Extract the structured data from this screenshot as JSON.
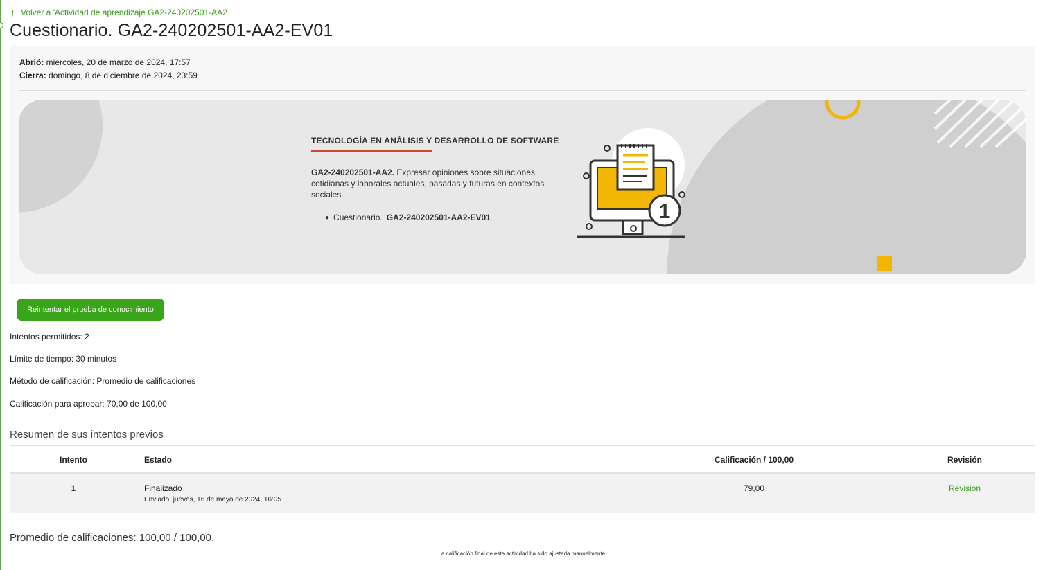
{
  "nav": {
    "back_label": "Volver a 'Actividad de aprendizaje GA2-240202501-AA2",
    "back_icon": "arrow-up-icon"
  },
  "page": {
    "title": "Cuestionario. GA2-240202501-AA2-EV01"
  },
  "dates": {
    "opened_label": "Abrió:",
    "opened_value": "miércoles, 20 de marzo de 2024, 17:57",
    "closes_label": "Cierra:",
    "closes_value": "domingo, 8 de diciembre de 2024, 23:59"
  },
  "banner": {
    "program": "TECNOLOGÍA EN ANÁLISIS Y DESARROLLO DE SOFTWARE",
    "activity_code": "GA2-240202501-AA2.",
    "activity_desc": "Expresar opiniones sobre situaciones cotidianas y laborales actuales, pasadas y futuras en contextos sociales.",
    "item_prefix": "Cuestionario.",
    "item_code": "GA2-240202501-AA2-EV01",
    "illustration_number": "1",
    "accent_color": "#f2b705",
    "underline_color": "#d2462c"
  },
  "actions": {
    "retry_label": "Reintentar el prueba de conocimiento",
    "button_color": "#39a51a"
  },
  "quiz_info": {
    "attempts": "Intentos permitidos: 2",
    "time_limit": "Límite de tiempo: 30 minutos",
    "grading_method": "Método de calificación: Promedio de calificaciones",
    "pass_grade": "Calificación para aprobar: 70,00 de 100,00"
  },
  "summary": {
    "title": "Resumen de sus intentos previos",
    "headers": {
      "attempt": "Intento",
      "state": "Estado",
      "grade": "Calificación / 100,00",
      "review": "Revisión"
    },
    "rows": [
      {
        "attempt": "1",
        "state": "Finalizado",
        "submitted": "Enviado: jueves, 16 de mayo de 2024, 16:05",
        "grade": "79,00",
        "review": "Revisión"
      }
    ]
  },
  "footer": {
    "average": "Promedio de calificaciones: 100,00 / 100,00.",
    "note": "La calificación final de esta actividad ha sido ajustada manualmente."
  }
}
